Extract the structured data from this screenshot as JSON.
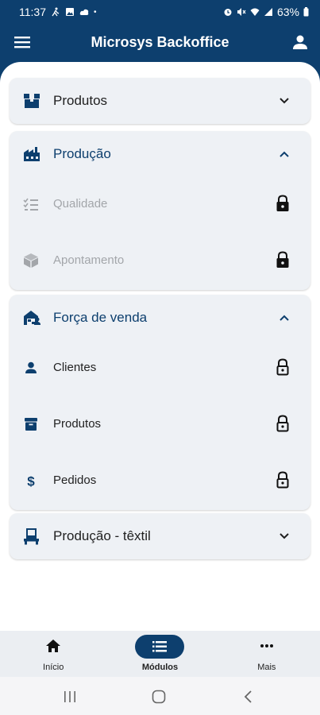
{
  "status_bar": {
    "time": "11:37",
    "battery": "63%"
  },
  "app_bar": {
    "title": "Microsys Backoffice"
  },
  "cards": {
    "produtos": {
      "title": "Produtos",
      "icon": "box-icon"
    },
    "producao": {
      "title": "Produção",
      "icon": "factory-icon",
      "items": [
        {
          "label": "Qualidade",
          "icon": "checklist-icon",
          "locked": true
        },
        {
          "label": "Apontamento",
          "icon": "cube-icon",
          "locked": true
        }
      ]
    },
    "forca_venda": {
      "title": "Força de venda",
      "icon": "sales-icon",
      "items": [
        {
          "label": "Clientes",
          "icon": "person-icon",
          "locked": false
        },
        {
          "label": "Produtos",
          "icon": "archive-icon",
          "locked": false
        },
        {
          "label": "Pedidos",
          "icon": "dollar-icon",
          "locked": false
        }
      ]
    },
    "producao_textil": {
      "title": "Produção - têxtil",
      "icon": "loom-icon"
    }
  },
  "bottom_nav": {
    "items": [
      {
        "label": "Início",
        "icon": "home-icon"
      },
      {
        "label": "Módulos",
        "icon": "list-icon",
        "active": true
      },
      {
        "label": "Mais",
        "icon": "more-icon"
      }
    ]
  },
  "colors": {
    "primary": "#0d3f6e",
    "card_bg": "#eef1f5",
    "disabled_text": "#a3a6aa"
  }
}
